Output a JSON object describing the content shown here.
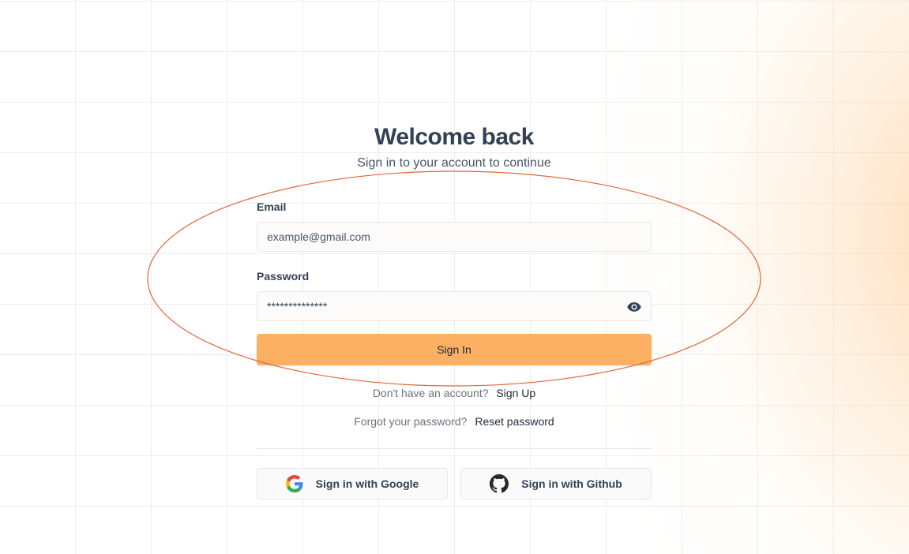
{
  "header": {
    "title": "Welcome back",
    "subtitle": "Sign in to your account to continue"
  },
  "form": {
    "email_label": "Email",
    "email_value": "",
    "email_placeholder": "example@gmail.com",
    "password_label": "Password",
    "password_value": "**************",
    "password_visibility_icon": "eye-icon",
    "submit_label": "Sign In"
  },
  "links": {
    "signup_prompt": "Don't have an account?",
    "signup_label": "Sign Up",
    "forgot_prompt": "Forgot your password?",
    "reset_label": "Reset password"
  },
  "social": {
    "google_label": "Sign in with Google",
    "google_icon": "google-icon",
    "github_label": "Sign in with Github",
    "github_icon": "github-icon"
  },
  "colors": {
    "accent": "#fbb062",
    "annotation": "#e0673a",
    "heading": "#334155"
  }
}
